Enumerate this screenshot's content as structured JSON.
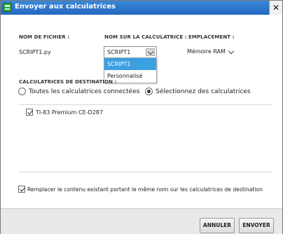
{
  "window": {
    "title": "Envoyer aux calculatrices",
    "close_glyph": "✕"
  },
  "headers": {
    "filename": "NOM DE FICHIER :",
    "calc_name": "NOM SUR LA CALCULATRICE :",
    "location": "EMPLACEMENT :"
  },
  "file": {
    "name": "SCRIPT1.py",
    "calc_name_selected": "SCRIPT1",
    "calc_name_options": [
      "SCRIPT1",
      "Personnalisé"
    ],
    "location_selected": "Mémoire RAM"
  },
  "destinations": {
    "header": "CALCULATRICES DE DESTINATION :",
    "option_all": "Toutes les calculatrices connectées",
    "option_select": "Sélectionnez des calculatrices",
    "selected_option": "select",
    "calculators": [
      {
        "name": "TI-83 Premium CE-D287",
        "checked": true
      }
    ]
  },
  "replace": {
    "label": "Remplacer le contenu existant portant le même nom sur les calculatrices de destination",
    "checked": true
  },
  "buttons": {
    "cancel": "ANNULER",
    "send": "ENVOYER"
  },
  "colors": {
    "titlebar": "#2a72c8",
    "highlight": "#3c9fe0"
  },
  "icons": {
    "app": "calculator-app-icon",
    "close": "close-icon",
    "dropdown": "chevron-down-icon"
  }
}
